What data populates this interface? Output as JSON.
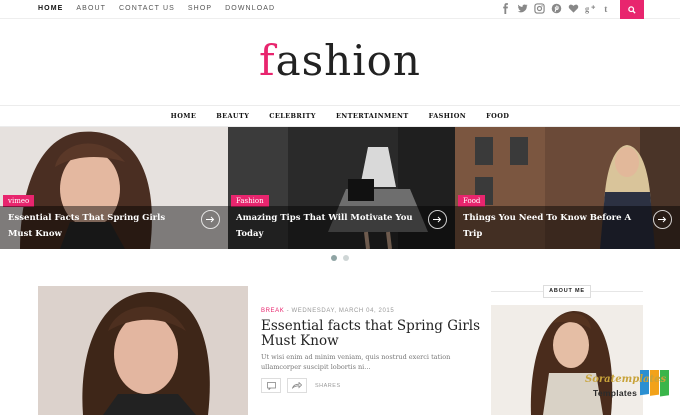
{
  "topbar": {
    "nav": [
      "HOME",
      "ABOUT",
      "CONTACT US",
      "SHOP",
      "DOWNLOAD"
    ],
    "social_icons": [
      "facebook-icon",
      "twitter-icon",
      "instagram-icon",
      "pinterest-icon",
      "heart-icon",
      "google-plus-icon",
      "tumblr-icon"
    ],
    "search_icon": "search-icon"
  },
  "logo": {
    "first": "f",
    "rest": "ashion"
  },
  "mainnav": [
    "HOME",
    "BEAUTY",
    "CELEBRITY",
    "ENTERTAINMENT",
    "FASHION",
    "FOOD"
  ],
  "slides": [
    {
      "badge": "vimeo",
      "title": "Essential Facts That Spring Girls Must Know"
    },
    {
      "badge": "Fashion",
      "title": "Amazing Tips That Will Motivate You Today"
    },
    {
      "badge": "Food",
      "title": "Things You Need To Know Before A Trip"
    }
  ],
  "post": {
    "category": "BREAK",
    "date": " - WEDNESDAY, MARCH 04, 2015",
    "title": "Essential facts that Spring Girls Must Know",
    "excerpt": "Ut wisi enim ad minim veniam, quis nostrud exerci tation ullamcorper suscipit lobortis ni...",
    "shares_label": "SHARES"
  },
  "sidebar": {
    "about_label": "ABOUT ME"
  },
  "watermark": {
    "line1": "Soratemplates",
    "line2": "Templates"
  },
  "colors": {
    "accent": "#e8256e"
  }
}
